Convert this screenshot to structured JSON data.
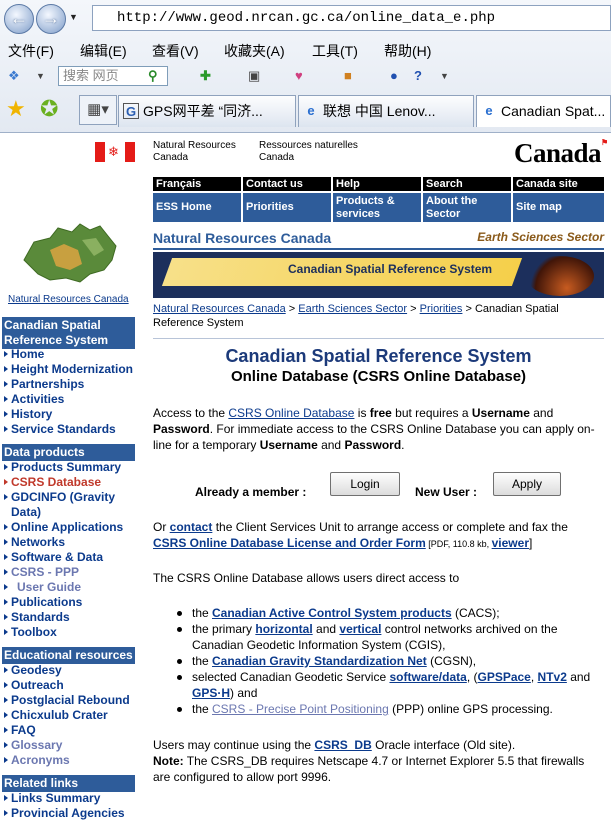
{
  "browser": {
    "address": "http://www.geod.nrcan.gc.ca/online_data_e.php",
    "menus": [
      "文件(F)",
      "编辑(E)",
      "查看(V)",
      "收藏夹(A)",
      "工具(T)",
      "帮助(H)"
    ],
    "search_placeholder": "搜索 网页",
    "tabs": [
      {
        "label": "GPS网平差 “同济...",
        "icon": "google-icon"
      },
      {
        "label": "联想 中国 Lenov...",
        "icon": "ie-icon"
      },
      {
        "label": "Canadian Spat...",
        "icon": "ie-icon"
      }
    ]
  },
  "header": {
    "nrc_en": [
      "Natural Resources",
      "Canada"
    ],
    "nrc_fr": [
      "Ressources naturelles",
      "Canada"
    ],
    "wordmark": "Canada",
    "topnav_row1": [
      "Français",
      "Contact us",
      "Help",
      "Search",
      "Canada site"
    ],
    "topnav_row2": [
      "ESS Home",
      "Priorities",
      "Products & services",
      "About the Sector",
      "Site map"
    ],
    "banner_left": "Natural Resources Canada",
    "banner_right": "Earth Sciences Sector",
    "banner_title": "Canadian Spatial Reference System"
  },
  "breadcrumb": {
    "links": [
      "Natural Resources Canada",
      "Earth Sciences Sector",
      "Priorities"
    ],
    "current": "Canadian Spatial Reference System"
  },
  "sidebar": {
    "map_label": "Natural Resources Canada",
    "sections": [
      {
        "title": "Canadian Spatial Reference System",
        "items": [
          "Home",
          "Height Modernization",
          "Partnerships",
          "Activities",
          "History",
          "Service Standards"
        ]
      },
      {
        "title": "Data products",
        "items": [
          "Products Summary",
          "CSRS Database",
          "GDCINFO (Gravity Data)",
          "Online Applications",
          "Networks",
          "Software & Data",
          "CSRS - PPP",
          "User Guide",
          "Publications",
          "Standards",
          "Toolbox"
        ]
      },
      {
        "title": "Educational resources",
        "items": [
          "Geodesy",
          "Outreach",
          "Postglacial Rebound",
          "Chicxulub Crater",
          "FAQ",
          "Glossary",
          "Acronyms"
        ]
      },
      {
        "title": "Related links",
        "items": [
          "Links Summary",
          "Provincial Agencies"
        ]
      }
    ]
  },
  "main": {
    "title": "Canadian Spatial Reference System",
    "subtitle": "Online Database (CSRS Online Database)",
    "intro": {
      "t1": "Access to the ",
      "link": "CSRS Online Database",
      "t2": " is ",
      "free": "free",
      "t3": " but requires a ",
      "username": "Username",
      "t4": " and ",
      "password": "Password",
      "t5": ". For immediate access to the CSRS Online Database you can apply on-line for a temporary ",
      "username2": "Username",
      "t6": " and ",
      "password2": "Password",
      "t7": "."
    },
    "member_label": "Already a member :",
    "login_button": "Login",
    "newuser_label": "New User :",
    "apply_button": "Apply",
    "contact": {
      "t1": "Or ",
      "link": "contact",
      "t2": " the Client Services Unit to arrange access or complete and fax the ",
      "form": "CSRS Online Database License and Order Form",
      "pdf": " [PDF, 110.8 kb, ",
      "viewer": "viewer",
      "close": "]"
    },
    "allows": "The CSRS Online Database allows users direct access to",
    "bullets": {
      "b1": {
        "t1": "the ",
        "link": "Canadian Active Control System products",
        "t2": " (CACS);"
      },
      "b2": {
        "t1": "the primary ",
        "l1": "horizontal",
        "t2": " and ",
        "l2": "vertical",
        "t3": " control networks archived on the Canadian Geodetic Information System (CGIS),"
      },
      "b3": {
        "t1": "the ",
        "link": "Canadian Gravity Standardization Net",
        "t2": " (CGSN),"
      },
      "b4": {
        "t1": "selected Canadian Geodetic Service ",
        "l1": "software/data",
        "t2": ", (",
        "l2": "GPSPace",
        "t3": ", ",
        "l3": "NTv2",
        "t4": " and ",
        "l4": "GPS·H",
        "t5": ") and"
      },
      "b5": {
        "t1": "the ",
        "link": "CSRS - Precise Point Positioning",
        "t2": " (PPP) online GPS processing."
      }
    },
    "old": {
      "t1": "Users may continue using the ",
      "link": "CSRS_DB",
      "t2": " Oracle interface (Old site).",
      "note": "Note:",
      "t3": " The CSRS_DB requires Netscape 4.7 or Internet Explorer 5.5 that firewalls are configured to allow port 9996."
    }
  },
  "colors": {
    "nav_blue": "#2e5c9a",
    "link": "#0b3a8c",
    "flag_red": "#e41b17",
    "current_item": "#c0392b"
  }
}
